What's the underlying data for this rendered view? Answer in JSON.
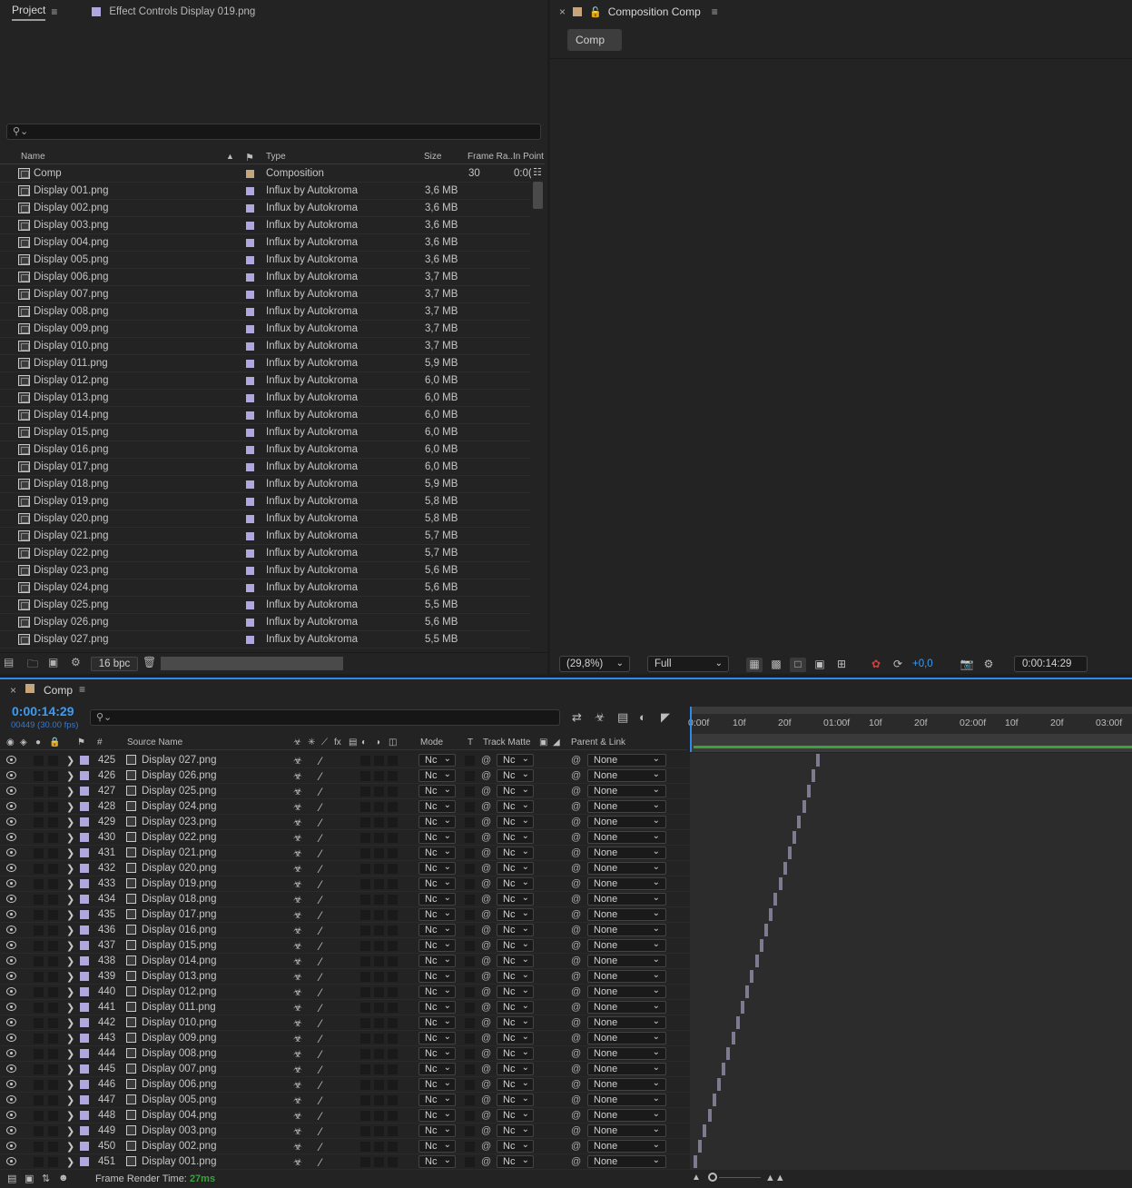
{
  "project": {
    "tab_label": "Project",
    "menu_glyph": "≡",
    "tab2_label": "Effect Controls Display 019.png",
    "search_icon": "search-icon",
    "columns": {
      "name": "Name",
      "type": "Type",
      "size": "Size",
      "frame_rate": "Frame Ra..",
      "in_point": "In Point"
    },
    "rows": [
      {
        "name": "Comp",
        "type": "Composition",
        "size": "",
        "frame_rate": "30",
        "in_point": "0:0("
      },
      {
        "name": "Display 001.png",
        "type": "Influx by Autokroma",
        "size": "3,6 MB"
      },
      {
        "name": "Display 002.png",
        "type": "Influx by Autokroma",
        "size": "3,6 MB"
      },
      {
        "name": "Display 003.png",
        "type": "Influx by Autokroma",
        "size": "3,6 MB"
      },
      {
        "name": "Display 004.png",
        "type": "Influx by Autokroma",
        "size": "3,6 MB"
      },
      {
        "name": "Display 005.png",
        "type": "Influx by Autokroma",
        "size": "3,6 MB"
      },
      {
        "name": "Display 006.png",
        "type": "Influx by Autokroma",
        "size": "3,7 MB"
      },
      {
        "name": "Display 007.png",
        "type": "Influx by Autokroma",
        "size": "3,7 MB"
      },
      {
        "name": "Display 008.png",
        "type": "Influx by Autokroma",
        "size": "3,7 MB"
      },
      {
        "name": "Display 009.png",
        "type": "Influx by Autokroma",
        "size": "3,7 MB"
      },
      {
        "name": "Display 010.png",
        "type": "Influx by Autokroma",
        "size": "3,7 MB"
      },
      {
        "name": "Display 011.png",
        "type": "Influx by Autokroma",
        "size": "5,9 MB"
      },
      {
        "name": "Display 012.png",
        "type": "Influx by Autokroma",
        "size": "6,0 MB"
      },
      {
        "name": "Display 013.png",
        "type": "Influx by Autokroma",
        "size": "6,0 MB"
      },
      {
        "name": "Display 014.png",
        "type": "Influx by Autokroma",
        "size": "6,0 MB"
      },
      {
        "name": "Display 015.png",
        "type": "Influx by Autokroma",
        "size": "6,0 MB"
      },
      {
        "name": "Display 016.png",
        "type": "Influx by Autokroma",
        "size": "6,0 MB"
      },
      {
        "name": "Display 017.png",
        "type": "Influx by Autokroma",
        "size": "6,0 MB"
      },
      {
        "name": "Display 018.png",
        "type": "Influx by Autokroma",
        "size": "5,9 MB"
      },
      {
        "name": "Display 019.png",
        "type": "Influx by Autokroma",
        "size": "5,8 MB"
      },
      {
        "name": "Display 020.png",
        "type": "Influx by Autokroma",
        "size": "5,8 MB"
      },
      {
        "name": "Display 021.png",
        "type": "Influx by Autokroma",
        "size": "5,7 MB"
      },
      {
        "name": "Display 022.png",
        "type": "Influx by Autokroma",
        "size": "5,7 MB"
      },
      {
        "name": "Display 023.png",
        "type": "Influx by Autokroma",
        "size": "5,6 MB"
      },
      {
        "name": "Display 024.png",
        "type": "Influx by Autokroma",
        "size": "5,6 MB"
      },
      {
        "name": "Display 025.png",
        "type": "Influx by Autokroma",
        "size": "5,5 MB"
      },
      {
        "name": "Display 026.png",
        "type": "Influx by Autokroma",
        "size": "5,6 MB"
      },
      {
        "name": "Display 027.png",
        "type": "Influx by Autokroma",
        "size": "5,5 MB"
      }
    ],
    "bpc_label": "16 bpc"
  },
  "composition": {
    "tab_label": "Composition Comp",
    "menu_glyph": "≡",
    "close_glyph": "×",
    "comp_button": "Comp",
    "zoom": "(29,8%)",
    "resolution": "Full",
    "exposure": "+0,0",
    "timecode": "0:00:14:29"
  },
  "timeline": {
    "tab_label": "Comp",
    "menu_glyph": "≡",
    "close_glyph": "×",
    "timecode": "0:00:14:29",
    "frames": "00449 (30.00 fps)",
    "ruler_ticks": [
      "0:00f",
      "10f",
      "20f",
      "01:00f",
      "10f",
      "20f",
      "02:00f",
      "10f",
      "20f",
      "03:00f"
    ],
    "columns": {
      "num": "#",
      "source": "Source Name",
      "mode": "Mode",
      "t": "T",
      "track_matte": "Track Matte",
      "parent": "Parent & Link"
    },
    "mode_value": "Nc",
    "matte_value": "Nc",
    "parent_value": "None",
    "layers": [
      {
        "num": "425",
        "name": "Display 027.png"
      },
      {
        "num": "426",
        "name": "Display 026.png"
      },
      {
        "num": "427",
        "name": "Display 025.png"
      },
      {
        "num": "428",
        "name": "Display 024.png"
      },
      {
        "num": "429",
        "name": "Display 023.png"
      },
      {
        "num": "430",
        "name": "Display 022.png"
      },
      {
        "num": "431",
        "name": "Display 021.png"
      },
      {
        "num": "432",
        "name": "Display 020.png"
      },
      {
        "num": "433",
        "name": "Display 019.png"
      },
      {
        "num": "434",
        "name": "Display 018.png"
      },
      {
        "num": "435",
        "name": "Display 017.png"
      },
      {
        "num": "436",
        "name": "Display 016.png"
      },
      {
        "num": "437",
        "name": "Display 015.png"
      },
      {
        "num": "438",
        "name": "Display 014.png"
      },
      {
        "num": "439",
        "name": "Display 013.png"
      },
      {
        "num": "440",
        "name": "Display 012.png"
      },
      {
        "num": "441",
        "name": "Display 011.png"
      },
      {
        "num": "442",
        "name": "Display 010.png"
      },
      {
        "num": "443",
        "name": "Display 009.png"
      },
      {
        "num": "444",
        "name": "Display 008.png"
      },
      {
        "num": "445",
        "name": "Display 007.png"
      },
      {
        "num": "446",
        "name": "Display 006.png"
      },
      {
        "num": "447",
        "name": "Display 005.png"
      },
      {
        "num": "448",
        "name": "Display 004.png"
      },
      {
        "num": "449",
        "name": "Display 003.png"
      },
      {
        "num": "450",
        "name": "Display 002.png"
      },
      {
        "num": "451",
        "name": "Display 001.png"
      }
    ],
    "render_label": "Frame Render Time:",
    "render_value": "27ms"
  },
  "colors": {
    "accent": "#2d8ceb",
    "label_lavender": "#b1a6e0",
    "label_tan": "#c7a57c",
    "render_green": "#3aa23a"
  }
}
